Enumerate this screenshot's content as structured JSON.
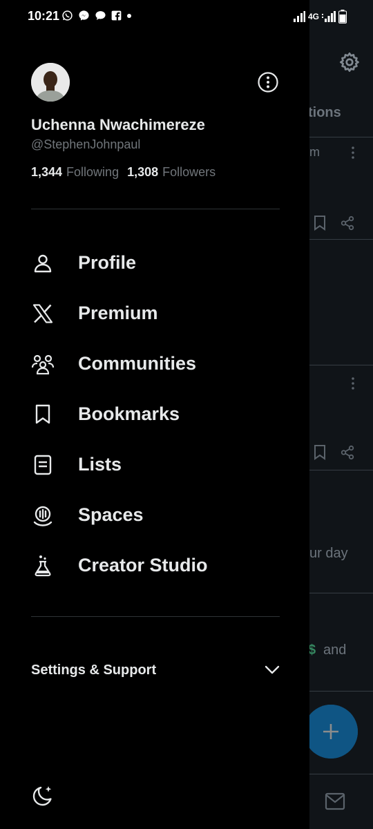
{
  "status_bar": {
    "time": "10:21",
    "network": "4G",
    "left_icons": [
      "whatsapp-icon",
      "messenger-icon",
      "chat-icon",
      "facebook-icon",
      "dot-icon"
    ],
    "right_icons": [
      "signal-icon",
      "signal-icon",
      "battery-icon"
    ]
  },
  "profile": {
    "name": "Uchenna Nwachimereze",
    "handle": "@StephenJohnpaul",
    "following_count": "1,344",
    "following_label": "Following",
    "followers_count": "1,308",
    "followers_label": "Followers"
  },
  "nav": {
    "items": [
      {
        "label": "Profile",
        "icon": "person-icon"
      },
      {
        "label": "Premium",
        "icon": "x-logo-icon"
      },
      {
        "label": "Communities",
        "icon": "communities-icon"
      },
      {
        "label": "Bookmarks",
        "icon": "bookmark-icon"
      },
      {
        "label": "Lists",
        "icon": "list-icon"
      },
      {
        "label": "Spaces",
        "icon": "spaces-icon"
      },
      {
        "label": "Creator Studio",
        "icon": "flask-icon"
      }
    ]
  },
  "settings": {
    "label": "Settings & Support"
  },
  "background": {
    "tab_fragment": "tions",
    "post1_fragment": "m",
    "post3_fragment": "ur day",
    "post4_fragment": "and",
    "post4_symbol": "$"
  },
  "colors": {
    "background": "#000000",
    "text": "#e7e9ea",
    "muted": "#71767b",
    "divider": "#2f3336",
    "accent": "#1d9bf0"
  }
}
